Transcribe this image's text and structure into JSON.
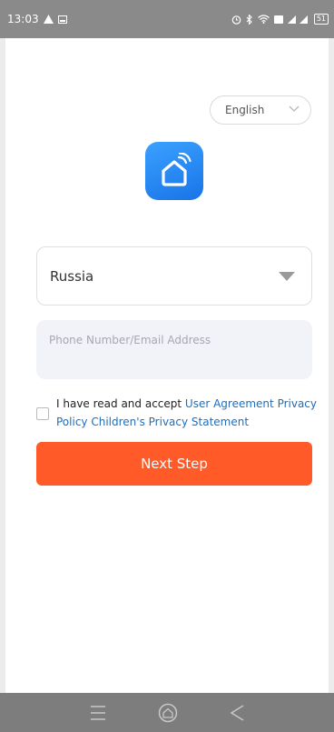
{
  "status_bar": {
    "time": "13:03",
    "battery": "51"
  },
  "language_selector": {
    "value": "English"
  },
  "country_selector": {
    "value": "Russia"
  },
  "account_input": {
    "placeholder": "Phone Number/Email Address",
    "value": ""
  },
  "agreement": {
    "prefix": "I have read and accept ",
    "user_agreement": "User Agreement",
    "privacy_policy": "Privacy Policy",
    "children_privacy": "Children's Privacy Statement"
  },
  "next_button": {
    "label": "Next Step"
  },
  "colors": {
    "accent": "#ff5a28",
    "link": "#1b6ec2",
    "logo": "#1a74e8"
  },
  "icons": {
    "status_left": [
      "warning-icon",
      "image-icon"
    ],
    "status_right": [
      "alarm-icon",
      "bluetooth-icon",
      "wifi-icon",
      "hd-icon",
      "signal-icon",
      "battery-icon"
    ],
    "nav": [
      "menu-icon",
      "home-icon",
      "back-icon"
    ]
  }
}
